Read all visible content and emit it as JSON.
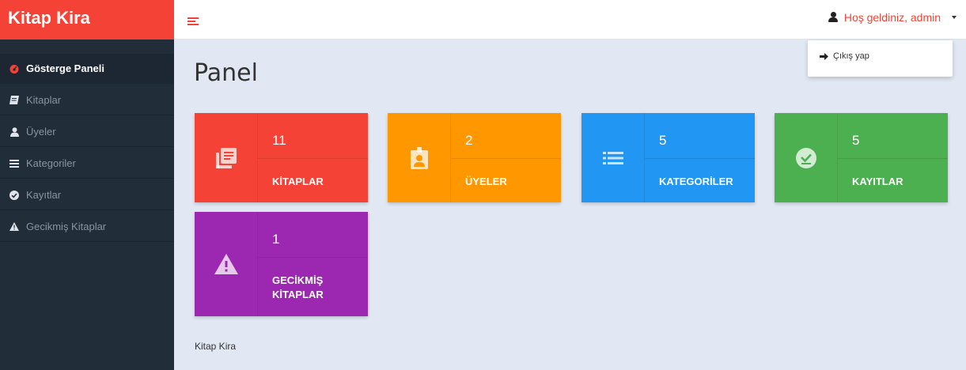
{
  "brand": {
    "title": "Kitap Kira"
  },
  "header": {
    "welcome": "Hoş geldiniz, admin"
  },
  "dropdown": {
    "logout": "Çıkış yap"
  },
  "sidebar": {
    "items": [
      {
        "label": "Gösterge Paneli",
        "icon": "dashboard-icon",
        "active": true
      },
      {
        "label": "Kitaplar",
        "icon": "book-icon"
      },
      {
        "label": "Üyeler",
        "icon": "user-icon"
      },
      {
        "label": "Kategoriler",
        "icon": "list-icon"
      },
      {
        "label": "Kayıtlar",
        "icon": "check-circle-icon"
      },
      {
        "label": "Gecikmiş Kitaplar",
        "icon": "warning-icon"
      }
    ]
  },
  "main": {
    "title": "Panel"
  },
  "cards": [
    {
      "count": "11",
      "label": "KİTAPLAR",
      "color": "#f44336",
      "icon": "library-books-icon"
    },
    {
      "count": "2",
      "label": "ÜYELER",
      "color": "#ff9800",
      "icon": "badge-icon"
    },
    {
      "count": "5",
      "label": "KATEGORİLER",
      "color": "#2196f3",
      "icon": "list-icon"
    },
    {
      "count": "5",
      "label": "KAYITLAR",
      "color": "#4caf50",
      "icon": "check-circle-icon"
    },
    {
      "count": "1",
      "label": "GECİKMİŞ KİTAPLAR",
      "color": "#9c27b0",
      "icon": "warning-icon"
    }
  ],
  "footer": {
    "text": "Kitap Kira"
  }
}
